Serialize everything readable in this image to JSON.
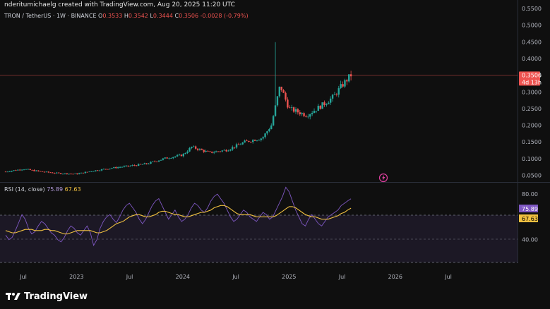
{
  "header": {
    "text": "nderitumichaelg created with TradingView.com, Aug 20, 2025 11:20 UTC"
  },
  "legend": {
    "symbol": "TRON / TetherUS · 1W · BINANCE",
    "o_label": "O",
    "o_value": "0.3533",
    "h_label": "H",
    "h_value": "0.3542",
    "l_label": "L",
    "l_value": "0.3444",
    "c_label": "C",
    "c_value": "0.3506",
    "change": "-0.0028 (-0.79%)"
  },
  "rsi_legend": {
    "label": "RSI (14, close)",
    "rsi_value": "75.89",
    "ma_value": "67.63"
  },
  "price_tag": {
    "value": "0.3506",
    "countdown": "4d 13h"
  },
  "rsi_tags": {
    "rsi": "75.89",
    "ma": "67.63"
  },
  "footer": {
    "brand": "TradingView"
  },
  "colors": {
    "up": "#26a69a",
    "down": "#ef5350",
    "rsi_line": "#7e57c2",
    "rsi_ma": "#f0c040",
    "background": "#0f0f0f"
  },
  "chart_data": [
    {
      "type": "candlestick",
      "title": "TRON / TetherUS · 1W · BINANCE",
      "y_axis": {
        "ticks": [
          "0.5500",
          "0.5000",
          "0.4500",
          "0.4000",
          "0.3500",
          "0.3000",
          "0.2500",
          "0.2000",
          "0.1500",
          "0.1000",
          "0.0500"
        ],
        "range": [
          0.03,
          0.55
        ]
      },
      "x_axis": {
        "ticks": [
          "Jul",
          "2023",
          "Jul",
          "2024",
          "Jul",
          "2025",
          "Jul",
          "2026",
          "Jul"
        ]
      },
      "series": [
        {
          "close_keypoints": [
            {
              "x": "2022-05",
              "y": 0.061
            },
            {
              "x": "2022-07",
              "y": 0.069
            },
            {
              "x": "2022-09",
              "y": 0.061
            },
            {
              "x": "2022-11",
              "y": 0.056
            },
            {
              "x": "2023-01",
              "y": 0.054
            },
            {
              "x": "2023-03",
              "y": 0.064
            },
            {
              "x": "2023-05",
              "y": 0.072
            },
            {
              "x": "2023-07",
              "y": 0.078
            },
            {
              "x": "2023-09",
              "y": 0.085
            },
            {
              "x": "2023-11",
              "y": 0.101
            },
            {
              "x": "2024-01",
              "y": 0.111
            },
            {
              "x": "2024-02",
              "y": 0.135
            },
            {
              "x": "2024-04",
              "y": 0.118
            },
            {
              "x": "2024-06",
              "y": 0.126
            },
            {
              "x": "2024-08",
              "y": 0.15
            },
            {
              "x": "2024-10",
              "y": 0.162
            },
            {
              "x": "2024-11",
              "y": 0.2
            },
            {
              "x": "2024-12",
              "y": 0.32
            },
            {
              "x": "2025-01",
              "y": 0.25
            },
            {
              "x": "2025-03",
              "y": 0.23
            },
            {
              "x": "2025-05",
              "y": 0.265
            },
            {
              "x": "2025-06",
              "y": 0.285
            },
            {
              "x": "2025-07",
              "y": 0.32
            },
            {
              "x": "2025-08",
              "y": 0.3506
            }
          ],
          "spike_high": 0.449
        }
      ],
      "current_price": 0.3506
    },
    {
      "type": "line",
      "title": "RSI (14, close)",
      "y_axis": {
        "ticks": [
          "80.00",
          "60.00",
          "40.00"
        ],
        "bands": [
          70,
          50,
          30
        ]
      },
      "series": [
        {
          "name": "RSI",
          "values": [
            44,
            40,
            42,
            48,
            55,
            62,
            58,
            50,
            45,
            47,
            52,
            56,
            54,
            50,
            46,
            44,
            40,
            38,
            42,
            48,
            52,
            50,
            46,
            44,
            48,
            52,
            46,
            35,
            40,
            50,
            56,
            60,
            62,
            58,
            55,
            60,
            66,
            70,
            72,
            68,
            64,
            58,
            54,
            58,
            64,
            70,
            74,
            76,
            70,
            64,
            58,
            62,
            66,
            60,
            56,
            58,
            62,
            68,
            72,
            70,
            66,
            64,
            68,
            74,
            78,
            80,
            76,
            72,
            66,
            60,
            56,
            58,
            62,
            66,
            64,
            60,
            58,
            56,
            60,
            64,
            62,
            58,
            60,
            66,
            72,
            78,
            86,
            82,
            74,
            66,
            60,
            54,
            52,
            58,
            62,
            58,
            54,
            52,
            56,
            60,
            62,
            64,
            66,
            70,
            72,
            74,
            75.89
          ]
        },
        {
          "name": "MA",
          "values": [
            48,
            47,
            46,
            46,
            47,
            48,
            49,
            49,
            49,
            48,
            48,
            48,
            49,
            49,
            48,
            48,
            47,
            46,
            45,
            45,
            46,
            47,
            48,
            48,
            48,
            48,
            48,
            47,
            46,
            46,
            47,
            48,
            50,
            52,
            54,
            55,
            56,
            58,
            60,
            61,
            62,
            62,
            61,
            60,
            60,
            61,
            62,
            64,
            65,
            65,
            64,
            63,
            62,
            62,
            61,
            60,
            60,
            61,
            62,
            63,
            64,
            64,
            65,
            66,
            68,
            69,
            70,
            70,
            69,
            67,
            65,
            63,
            62,
            62,
            62,
            62,
            61,
            60,
            60,
            60,
            60,
            60,
            60,
            61,
            63,
            65,
            67,
            69,
            69,
            68,
            66,
            64,
            62,
            61,
            60,
            60,
            59,
            58,
            58,
            58,
            59,
            60,
            61,
            63,
            64,
            66,
            67.63
          ]
        }
      ]
    }
  ]
}
